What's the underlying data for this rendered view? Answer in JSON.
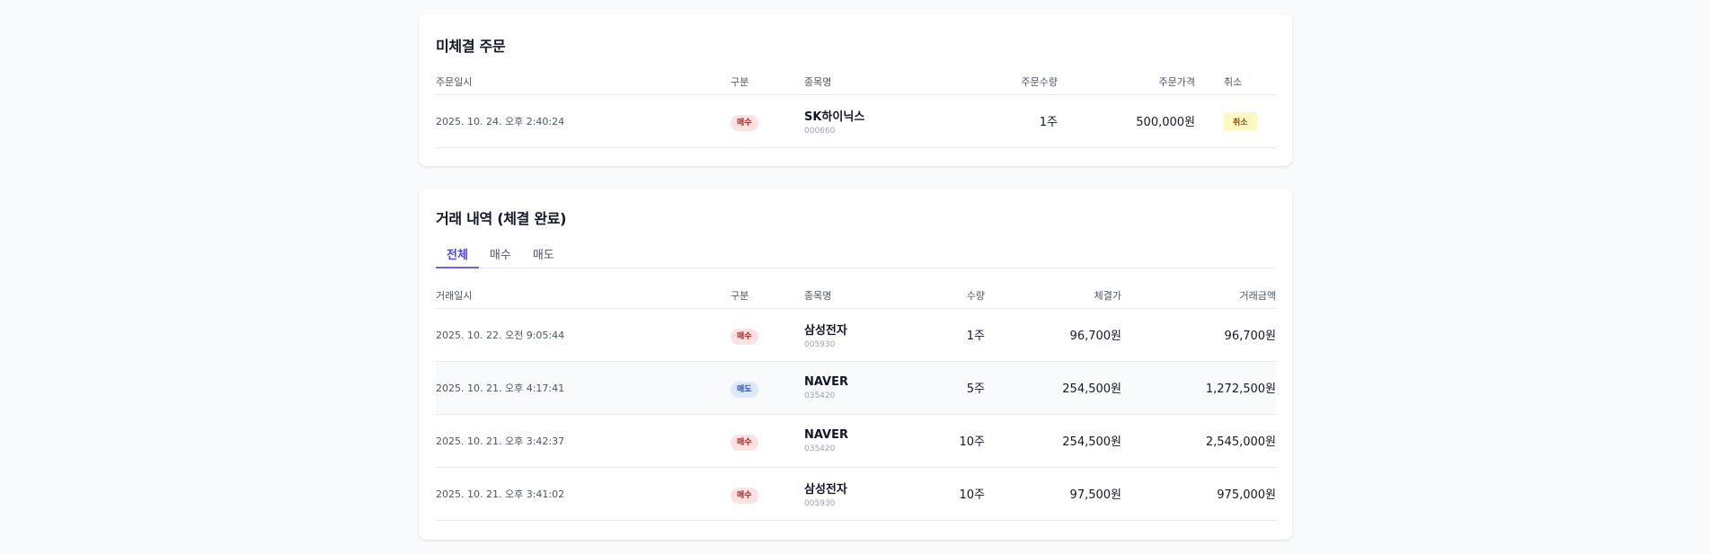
{
  "pending": {
    "title": "미체결 주문",
    "headers": {
      "datetime": "주문일시",
      "type": "구분",
      "stock": "종목명",
      "qty": "주문수량",
      "price": "주문가격",
      "cancel": "취소"
    },
    "rows": [
      {
        "datetime": "2025. 10. 24. 오후 2:40:24",
        "type": "매수",
        "name": "SK하이닉스",
        "code": "000660",
        "qty": "1주",
        "price": "500,000원",
        "cancel": "취소"
      }
    ]
  },
  "history": {
    "title": "거래 내역 (체결 완료)",
    "tabs": [
      "전체",
      "매수",
      "매도"
    ],
    "active_tab": "전체",
    "headers": {
      "datetime": "거래일시",
      "type": "구분",
      "stock": "종목명",
      "qty": "수량",
      "price": "체결가",
      "amount": "거래금액"
    },
    "rows": [
      {
        "datetime": "2025. 10. 22. 오전 9:05:44",
        "type": "매수",
        "name": "삼성전자",
        "code": "005930",
        "qty": "1주",
        "price": "96,700원",
        "amount": "96,700원"
      },
      {
        "datetime": "2025. 10. 21. 오후 4:17:41",
        "type": "매도",
        "name": "NAVER",
        "code": "035420",
        "qty": "5주",
        "price": "254,500원",
        "amount": "1,272,500원"
      },
      {
        "datetime": "2025. 10. 21. 오후 3:42:37",
        "type": "매수",
        "name": "NAVER",
        "code": "035420",
        "qty": "10주",
        "price": "254,500원",
        "amount": "2,545,000원"
      },
      {
        "datetime": "2025. 10. 21. 오후 3:41:02",
        "type": "매수",
        "name": "삼성전자",
        "code": "005930",
        "qty": "10주",
        "price": "97,500원",
        "amount": "975,000원"
      }
    ]
  },
  "colors": {
    "buy": "#b91c1c",
    "sell": "#1d4ed8",
    "accent": "#6366f1",
    "cancel_bg": "#fef9c3"
  }
}
